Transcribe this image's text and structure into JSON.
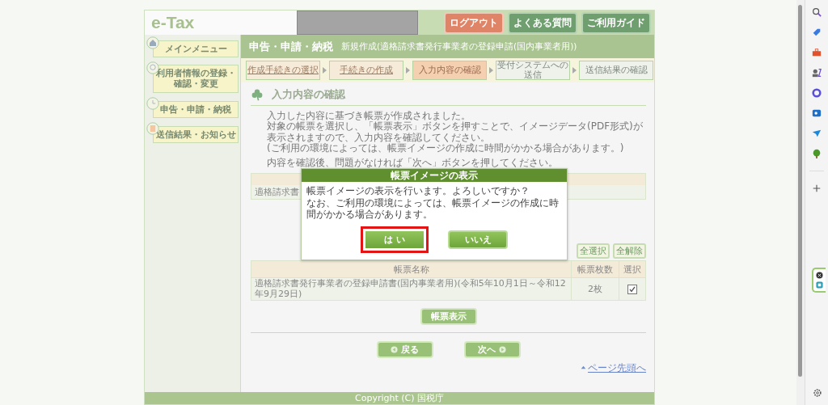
{
  "header": {
    "logo": "e-Tax",
    "buttons": [
      {
        "label": "ログアウト",
        "kind": "logout"
      },
      {
        "label": "よくある質問",
        "kind": "nav"
      },
      {
        "label": "ご利用ガイド",
        "kind": "nav"
      }
    ]
  },
  "sidebar": {
    "items": [
      {
        "label": "メインメニュー"
      },
      {
        "label": "利用者情報の登録・確認・変更"
      },
      {
        "label": "申告・申請・納税"
      },
      {
        "label": "送信結果・お知らせ"
      }
    ]
  },
  "title_bar": {
    "title": "申告・申請・納税",
    "subtitle": "新規作成(適格請求書発行事業者の登録申請(国内事業者用))"
  },
  "steps": [
    {
      "label": "作成手続きの選択",
      "kind": "done"
    },
    {
      "label": "手続きの作成",
      "kind": "done"
    },
    {
      "label": "入力内容の確認",
      "kind": "current"
    },
    {
      "label": "受付システムへの送信",
      "kind": "todo"
    },
    {
      "label": "送信結果の確認",
      "kind": "todo"
    }
  ],
  "section": {
    "heading": "入力内容の確認"
  },
  "paragraphs": [
    [
      "入力した内容に基づき帳票が作成されました。",
      "対象の帳票を選択し、「帳票表示」ボタンを押すことで、イメージデータ(PDF形式)が表示されますので、入力内容を確認してください。",
      "(ご利用の環境によっては、帳票イメージの作成に時間がかかる場合があります。)"
    ],
    [
      "内容を確認後、問題がなければ「次へ」ボタンを押してください。"
    ]
  ],
  "first_table": {
    "row_cell": "適格請求書"
  },
  "select_buttons": [
    "全選択",
    "全解除"
  ],
  "table": {
    "columns": [
      "帳票名称",
      "帳票枚数",
      "選択"
    ],
    "rows": [
      {
        "name": "適格請求書発行事業者の登録申請書(国内事業者用)(令和5年10月1日～令和12年9月29日)",
        "count": "2枚",
        "checked": true
      }
    ]
  },
  "show_button": "帳票表示",
  "nav_buttons": [
    {
      "label": "戻る",
      "kind": "back"
    },
    {
      "label": "次へ",
      "kind": "next"
    }
  ],
  "page_top_link": "ページ先頭へ",
  "footer": "Copyright (C) 国税庁",
  "dialog": {
    "title": "帳票イメージの表示",
    "message_lines": [
      "帳票イメージの表示を行います。よろしいですか？",
      "なお、ご利用の環境によっては、帳票イメージの作成に時間がかかる場合があります。"
    ],
    "buttons": [
      {
        "label": "は い",
        "highlighted": true
      },
      {
        "label": "いいえ",
        "highlighted": false
      }
    ]
  }
}
